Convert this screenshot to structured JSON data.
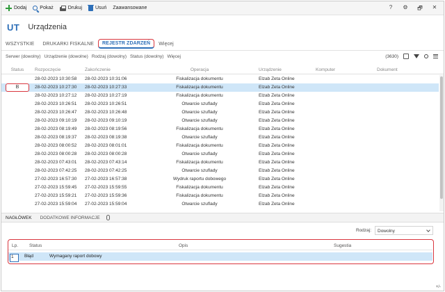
{
  "toolbar": {
    "add": "Dodaj",
    "show": "Pokaż",
    "print": "Drukuj",
    "delete": "Usuń",
    "advanced": "Zaawansowane",
    "help": "?",
    "settings": "⚙",
    "restore": "🗗",
    "close": "✕"
  },
  "header": {
    "module": "UT",
    "title": "Urządzenia"
  },
  "tabs": [
    {
      "label": "WSZYSTKIE"
    },
    {
      "label": "DRUKARKI FISKALNE"
    },
    {
      "label": "REJESTR ZDARZEŃ"
    },
    {
      "label": "Więcej"
    }
  ],
  "filters": [
    "Serwer (dowolny)",
    "Urządzenie (dowolne)",
    "Rodzaj (dowolny)",
    "Status (dowolny)",
    "Więcej"
  ],
  "count": "(3630)",
  "columns": {
    "status": "Status",
    "start": "Rozpoczęcie",
    "end": "Zakończenie",
    "op": "Operacja",
    "device": "Urządzenie",
    "computer": "Komputer",
    "document": "Dokument"
  },
  "rows": [
    {
      "status": "",
      "start": "28-02-2023 10:30:58",
      "end": "28-02-2023 10:31:06",
      "op": "Fiskalizacja dokumentu",
      "device": "Elzab Zeta Online"
    },
    {
      "status": "B",
      "start": "28-02-2023 10:27:30",
      "end": "28-02-2023 10:27:33",
      "op": "Fiskalizacja dokumentu",
      "device": "Elzab Zeta Online"
    },
    {
      "status": "",
      "start": "28-02-2023 10:27:12",
      "end": "28-02-2023 10:27:19",
      "op": "Fiskalizacja dokumentu",
      "device": "Elzab Zeta Online"
    },
    {
      "status": "",
      "start": "28-02-2023 10:26:51",
      "end": "28-02-2023 10:26:51",
      "op": "Otwarcie szuflady",
      "device": "Elzab Zeta Online"
    },
    {
      "status": "",
      "start": "28-02-2023 10:26:47",
      "end": "28-02-2023 10:26:48",
      "op": "Otwarcie szuflady",
      "device": "Elzab Zeta Online"
    },
    {
      "status": "",
      "start": "28-02-2023 09:10:19",
      "end": "28-02-2023 09:10:19",
      "op": "Otwarcie szuflady",
      "device": "Elzab Zeta Online"
    },
    {
      "status": "",
      "start": "28-02-2023 08:19:49",
      "end": "28-02-2023 08:19:56",
      "op": "Fiskalizacja dokumentu",
      "device": "Elzab Zeta Online"
    },
    {
      "status": "",
      "start": "28-02-2023 08:19:37",
      "end": "28-02-2023 08:19:38",
      "op": "Otwarcie szuflady",
      "device": "Elzab Zeta Online"
    },
    {
      "status": "",
      "start": "28-02-2023 08:00:52",
      "end": "28-02-2023 08:01:01",
      "op": "Fiskalizacja dokumentu",
      "device": "Elzab Zeta Online"
    },
    {
      "status": "",
      "start": "28-02-2023 08:00:28",
      "end": "28-02-2023 08:00:28",
      "op": "Otwarcie szuflady",
      "device": "Elzab Zeta Online"
    },
    {
      "status": "",
      "start": "28-02-2023 07:43:01",
      "end": "28-02-2023 07:43:14",
      "op": "Fiskalizacja dokumentu",
      "device": "Elzab Zeta Online"
    },
    {
      "status": "",
      "start": "28-02-2023 07:42:25",
      "end": "28-02-2023 07:42:25",
      "op": "Otwarcie szuflady",
      "device": "Elzab Zeta Online"
    },
    {
      "status": "",
      "start": "27-02-2023 16:57:30",
      "end": "27-02-2023 16:57:38",
      "op": "Wydruk raportu dobowego",
      "device": "Elzab Zeta Online"
    },
    {
      "status": "",
      "start": "27-02-2023 15:59:45",
      "end": "27-02-2023 15:59:55",
      "op": "Fiskalizacja dokumentu",
      "device": "Elzab Zeta Online"
    },
    {
      "status": "",
      "start": "27-02-2023 15:59:21",
      "end": "27-02-2023 15:59:36",
      "op": "Fiskalizacja dokumentu",
      "device": "Elzab Zeta Online"
    },
    {
      "status": "",
      "start": "27-02-2023 15:59:04",
      "end": "27-02-2023 15:59:04",
      "op": "Otwarcie szuflady",
      "device": "Elzab Zeta Online"
    }
  ],
  "bottom_tabs": [
    "NAGŁÓWEK",
    "DODATKOWE INFORMACJE"
  ],
  "rodzaj": {
    "label": "Rodzaj:",
    "value": "Dowolny"
  },
  "error_table": {
    "columns": {
      "lp": "Lp.",
      "status": "Status",
      "desc": "Opis",
      "hint": "Sugestia"
    },
    "row": {
      "lp": "1",
      "status": "Błąd",
      "desc": "Wymagany raport dobowy",
      "hint": ""
    }
  },
  "corner": "+/-",
  "colors": {
    "accent": "#2d6fb8",
    "highlight": "#d9363e",
    "selected_row": "#cfe6f8"
  }
}
